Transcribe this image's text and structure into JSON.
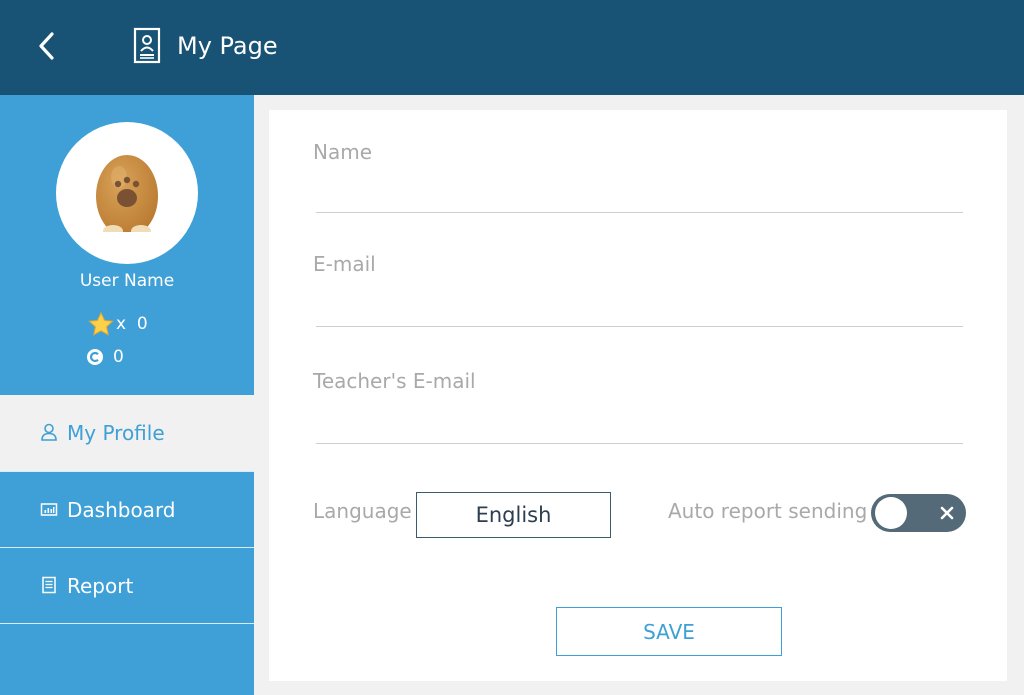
{
  "header": {
    "title": "My Page",
    "back_icon": "chevron-left-icon",
    "title_icon": "profile-document-icon"
  },
  "sidebar": {
    "user_name": "User Name",
    "stars": {
      "prefix": "x",
      "count": "0"
    },
    "coins": {
      "count": "0"
    },
    "nav": [
      {
        "label": "My Profile",
        "icon": "person-icon",
        "active": true
      },
      {
        "label": "Dashboard",
        "icon": "chart-icon",
        "active": false
      },
      {
        "label": "Report",
        "icon": "document-icon",
        "active": false
      }
    ]
  },
  "form": {
    "name_label": "Name",
    "name_value": "",
    "email_label": "E-mail",
    "email_value": "",
    "teacher_email_label": "Teacher's E-mail",
    "teacher_email_value": "",
    "language_label": "Language",
    "language_value": "English",
    "auto_report_label": "Auto report sending",
    "auto_report_enabled": false,
    "save_label": "SAVE"
  },
  "colors": {
    "header_bg": "#185274",
    "sidebar_bg": "#3ea0d6",
    "accent": "#3ea0d6",
    "toggle_bg": "#546a79",
    "label_text": "#a9a9a9"
  }
}
